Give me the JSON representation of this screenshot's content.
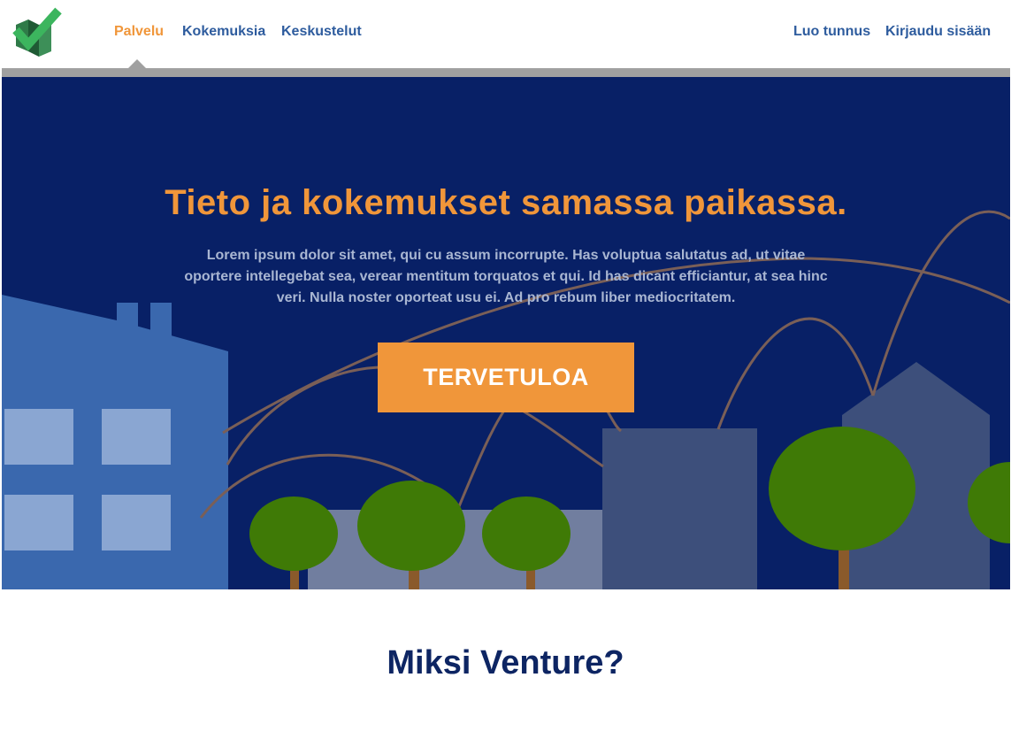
{
  "nav": {
    "left_items": [
      {
        "label": "Palvelu",
        "active": true
      },
      {
        "label": "Kokemuksia",
        "active": false
      },
      {
        "label": "Keskustelut",
        "active": false
      }
    ],
    "right_items": [
      {
        "label": "Luo tunnus"
      },
      {
        "label": "Kirjaudu sisään"
      }
    ],
    "logo_icon": "checkmark-building-icon"
  },
  "hero": {
    "title": "Tieto ja kokemukset samassa paikassa.",
    "text": "Lorem ipsum dolor sit amet, qui cu assum incorrupte. Has voluptua salutatus ad, ut vitae oportere intellegebat sea, verear mentitum torquatos et qui. Id has dicant efficiantur, at sea hinc veri. Nulla noster oporteat usu ei. Ad pro rebum liber mediocritatem.",
    "cta_label": "TERVETULOA"
  },
  "section": {
    "title": "Miksi Venture?"
  },
  "colors": {
    "accent": "#f0963a",
    "nav_link": "#2e5c9e",
    "hero_bg": "#082066",
    "section_title": "#0d2563"
  }
}
